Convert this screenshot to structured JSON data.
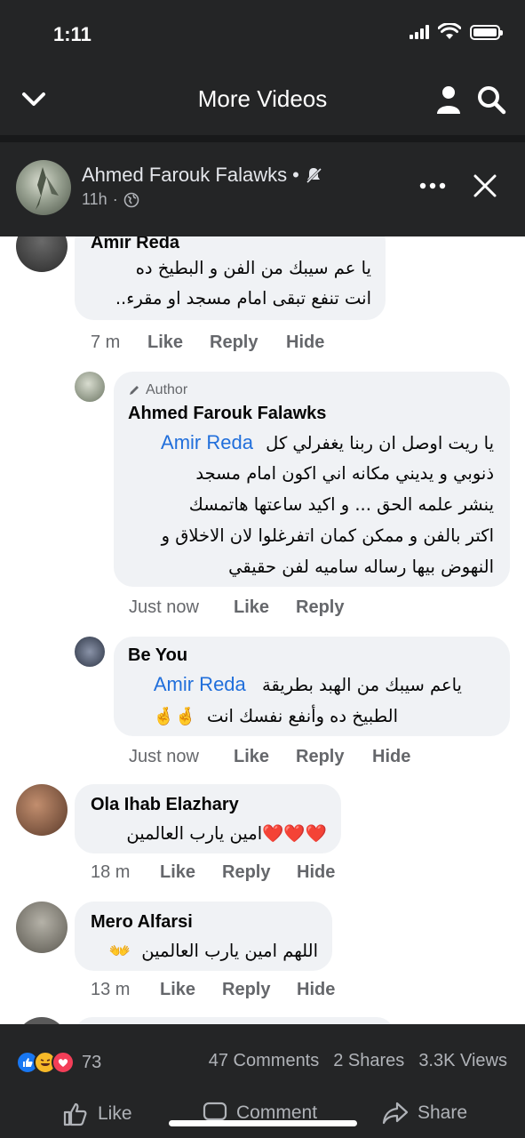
{
  "status_bar": {
    "time": "1:11"
  },
  "header": {
    "title": "More Videos",
    "back_icon": "chevron-down-icon",
    "profile_icon": "person-icon",
    "search_icon": "search-icon"
  },
  "post": {
    "author": "Ahmed Farouk Falawks",
    "separator": "•",
    "time": "11h",
    "meta_separator": "·"
  },
  "comments": [
    {
      "name": "Amir Reda",
      "lines": [
        "يا عم سيبك من الفن و البطيخ ده",
        "انت تنفع تبقى امام مسجد او مقرء.."
      ],
      "time": "7 m",
      "like": "Like",
      "reply": "Reply",
      "hide": "Hide"
    },
    {
      "badge": "Author",
      "name": "Ahmed Farouk Falawks",
      "mention": "Amir Reda",
      "line1_rest": "يا ريت اوصل ان ربنا يغفرلي كل",
      "lines": [
        "ذنوبي و يديني مكانه اني اكون امام مسجد",
        "ينشر علمه الحق ... و اكيد ساعتها هاتمسك",
        "اكتر بالفن و ممكن كمان اتفرغلوا لان الاخلاق و",
        "النهوض بيها رساله ساميه لفن حقيقي"
      ],
      "time": "Just now",
      "like": "Like",
      "reply": "Reply"
    },
    {
      "name": "Be You",
      "mention": "Amir Reda",
      "line1_rest": "ياعم سيبك من الهبد بطريقة",
      "line2": "الطبيخ ده وأنفع نفسك انت",
      "emoji": "🤞🤞",
      "time": "Just now",
      "like": "Like",
      "reply": "Reply",
      "hide": "Hide"
    },
    {
      "name": "Ola Ihab Elazhary",
      "text": "امين يارب العالمين",
      "emoji": "❤️❤️❤️",
      "time": "18 m",
      "like": "Like",
      "reply": "Reply",
      "hide": "Hide"
    },
    {
      "name": "Mero Alfarsi",
      "text": "اللهم امين يارب العالمين",
      "emoji": "👐",
      "time": "13 m",
      "like": "Like",
      "reply": "Reply",
      "hide": "Hide"
    }
  ],
  "stats": {
    "reaction_count": "73",
    "comments": "47 Comments",
    "shares": "2 Shares",
    "views": "3.3K Views"
  },
  "actions": {
    "like": "Like",
    "comment": "Comment",
    "share": "Share"
  },
  "colors": {
    "header_bg": "#242526",
    "mention": "#216fdb",
    "bubble": "#f0f2f5",
    "like_blue": "#1877f2",
    "love_red": "#f33e58",
    "haha_yellow": "#f7b928"
  }
}
